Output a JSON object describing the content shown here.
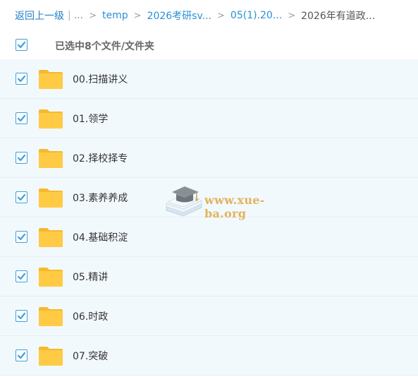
{
  "breadcrumb": {
    "back_label": "返回上一级",
    "separator": "|",
    "ellipsis": "...",
    "arrow": ">",
    "items": [
      "temp",
      "2026考研sv...",
      "05(1).20...",
      "2026年有道政..."
    ]
  },
  "selection": {
    "text": "已选中8个文件/文件夹",
    "all_checked": true
  },
  "files": [
    {
      "name": "00.扫描讲义",
      "checked": true,
      "type": "folder"
    },
    {
      "name": "01.领学",
      "checked": true,
      "type": "folder"
    },
    {
      "name": "02.择校择专",
      "checked": true,
      "type": "folder"
    },
    {
      "name": "03.素养养成",
      "checked": true,
      "type": "folder"
    },
    {
      "name": "04.基础积淀",
      "checked": true,
      "type": "folder"
    },
    {
      "name": "05.精讲",
      "checked": true,
      "type": "folder"
    },
    {
      "name": "06.时政",
      "checked": true,
      "type": "folder"
    },
    {
      "name": "07.突破",
      "checked": true,
      "type": "folder"
    }
  ],
  "watermark": {
    "text": "www.xue-ba.org",
    "icon": "graduation-cap-book-icon"
  },
  "colors": {
    "link": "#2a8fd6",
    "checkbox_check": "#3ea0dc",
    "row_bg": "#f2f9fd",
    "folder": "#ffcb45",
    "watermark": "#e3b45a"
  }
}
